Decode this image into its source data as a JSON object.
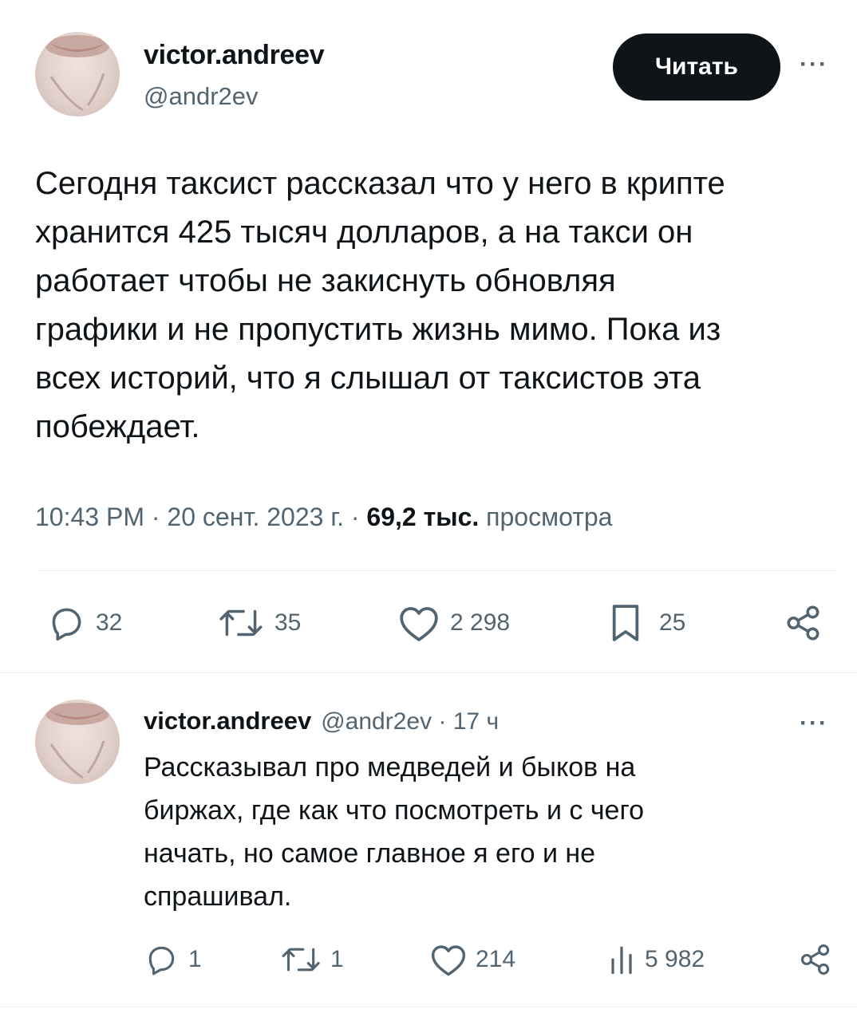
{
  "main_tweet": {
    "display_name": "victor.andreev",
    "handle": "@andr2ev",
    "follow_label": "Читать",
    "more_label": "···",
    "text_lines": [
      "Сегодня таксист рассказал что у него в крипте",
      "хранится 425 тысяч долларов, а на такси он",
      "работает чтобы не закиснуть обновляя",
      "графики и не пропустить жизнь мимо. Пока из",
      "всех историй, что я слышал от таксистов эта",
      "побеждает."
    ],
    "time": "10:43 PM · 20 сент. 2023 г. · ",
    "views_count": "69,2 тыс.",
    "views_label": " просмотра",
    "actions": {
      "replies": "32",
      "reposts": "35",
      "likes": "2 298",
      "bookmarks": "25"
    }
  },
  "reply_tweet": {
    "display_name": "victor.andreev",
    "handle_time": "@andr2ev · 17 ч",
    "more_label": "···",
    "text_lines": [
      "Рассказывал про медведей и быков на",
      "биржах, где как что посмотреть и с чего",
      "начать, но самое главное я его и не",
      "спрашивал."
    ],
    "actions": {
      "replies": "1",
      "reposts": "1",
      "likes": "214",
      "views": "5 982"
    }
  },
  "icons": {
    "reply": "speech-bubble-icon",
    "repost": "retweet-arrows-icon",
    "like": "heart-icon",
    "bookmark": "bookmark-icon",
    "views": "bar-chart-icon",
    "share": "share-nodes-icon"
  },
  "colors": {
    "text": "#0f1419",
    "secondary": "#536471",
    "divider": "#eff3f4",
    "button_bg": "#0f1419"
  }
}
